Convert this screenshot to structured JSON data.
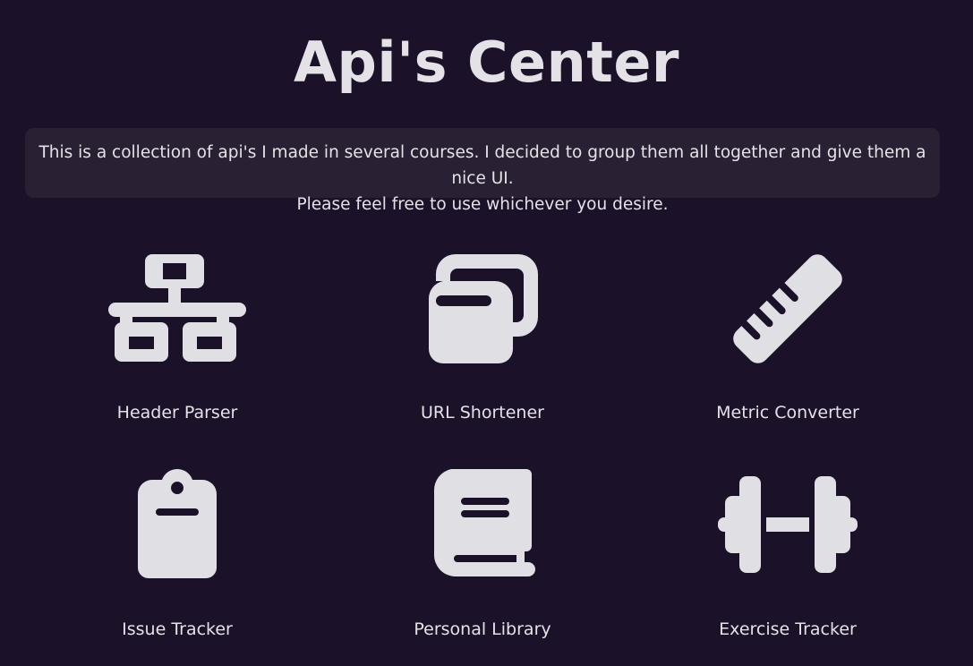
{
  "header": {
    "title": "Api's Center",
    "description_line1": "This is a collection of api's I made in several courses. I decided to group them all together and give them a nice UI.",
    "description_line2": "Please feel free to use whichever you desire."
  },
  "tiles": [
    {
      "label": "Header Parser",
      "icon": "network-icon"
    },
    {
      "label": "URL Shortener",
      "icon": "copy-icon"
    },
    {
      "label": "Metric Converter",
      "icon": "ruler-icon"
    },
    {
      "label": "Issue Tracker",
      "icon": "clipboard-icon"
    },
    {
      "label": "Personal Library",
      "icon": "book-icon"
    },
    {
      "label": "Exercise Tracker",
      "icon": "dumbbell-icon"
    }
  ],
  "colors": {
    "background": "#1b1229",
    "panel": "#292133",
    "text": "#e4e2e7",
    "icon": "#e0dfe3"
  }
}
